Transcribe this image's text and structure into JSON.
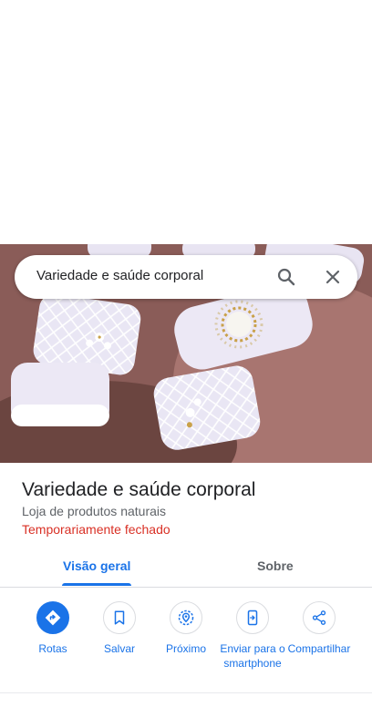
{
  "search": {
    "query": "Variedade e saúde corporal"
  },
  "hero": {
    "image_subject": "manicured nails with white lace design"
  },
  "place": {
    "title": "Variedade e saúde corporal",
    "category": "Loja de produtos naturais",
    "status": "Temporariamente fechado"
  },
  "tabs": [
    {
      "label": "Visão geral",
      "active": true
    },
    {
      "label": "Sobre",
      "active": false
    }
  ],
  "actions": [
    {
      "label": "Rotas",
      "icon": "directions-icon"
    },
    {
      "label": "Salvar",
      "icon": "bookmark-icon"
    },
    {
      "label": "Próximo",
      "icon": "nearby-icon"
    },
    {
      "label": "Enviar para o smartphone",
      "icon": "send-to-phone-icon"
    },
    {
      "label": "Compartilhar",
      "icon": "share-icon"
    }
  ],
  "colors": {
    "accent": "#1a73e8",
    "status_closed": "#d93025",
    "secondary_text": "#5f6368"
  }
}
